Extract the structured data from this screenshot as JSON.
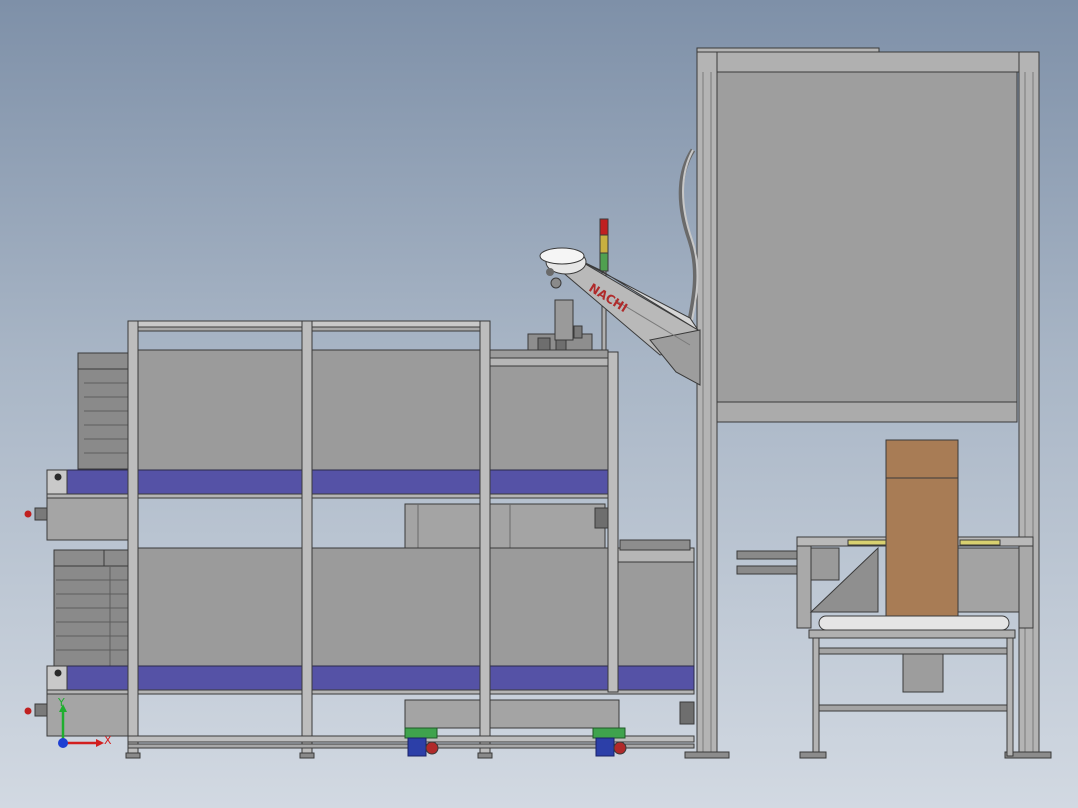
{
  "robot": {
    "brand_text": "NACHI"
  },
  "triad": {
    "x_label": "X",
    "y_label": "Y"
  },
  "colors": {
    "background_top": "#7e90a8",
    "background_bottom": "#d2d9e2",
    "frame": "#a7a7a7",
    "panel": "#9c9c9c",
    "belt": "#5552a6",
    "carton": "#a87c55",
    "robot_arm": "#b9b9b9",
    "axis_x": "#d21e1e",
    "axis_y": "#1fae2f",
    "axis_z": "#1e3fd2"
  }
}
